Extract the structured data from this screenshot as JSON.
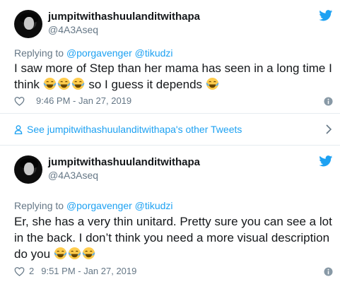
{
  "tweets": [
    {
      "name": "jumpitwithashuulanditwithapa",
      "handle": "@4A3Aseq",
      "replying_prefix": "Replying to ",
      "replying_to": "@porgavenger @tikudzi",
      "text_parts": [
        "I saw more of Step than her mama has seen in a long time I think ",
        " so I guess it depends "
      ],
      "time": "9:46 PM - Jan 27, 2019",
      "likes": ""
    },
    {
      "name": "jumpitwithashuulanditwithapa",
      "handle": "@4A3Aseq",
      "replying_prefix": "Replying to ",
      "replying_to": "@porgavenger @tikudzi",
      "text_parts": [
        "Er, she has a very thin unitard. Pretty sure you can see a lot in the back. I don’t think you need a more visual description do you "
      ],
      "time": "9:51 PM - Jan 27, 2019",
      "likes": "2"
    }
  ],
  "see_more": {
    "label": "See jumpitwithashuulanditwithapa's other Tweets"
  },
  "icons": {
    "brand": "twitter-bird-icon",
    "emoji": "face-with-tears-of-joy",
    "like": "heart-outline-icon",
    "info": "info-circle-icon"
  },
  "colors": {
    "accent": "#1da1f2",
    "muted": "#657786",
    "text": "#14171a",
    "emoji": "#ffcc4d"
  }
}
